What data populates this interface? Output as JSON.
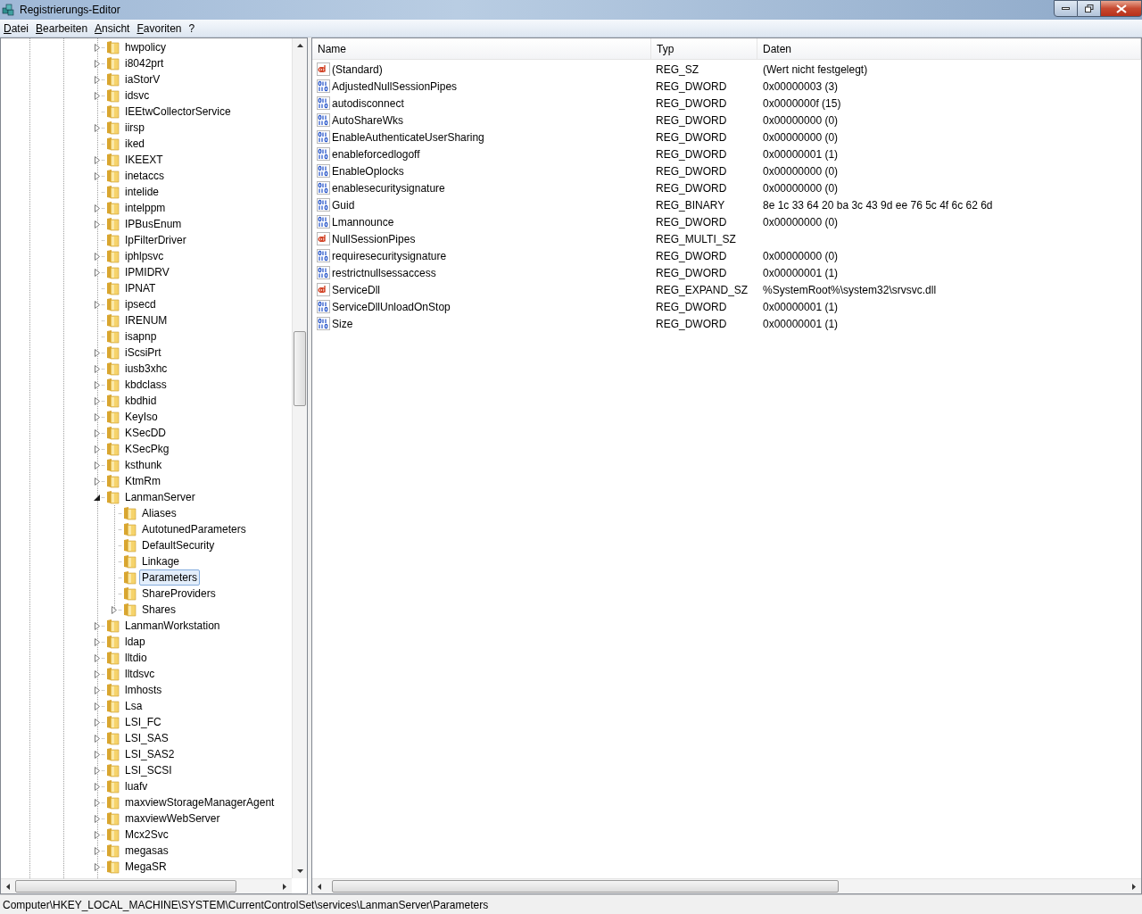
{
  "window": {
    "title": "Registrierungs-Editor"
  },
  "menu": [
    {
      "label": "Datei"
    },
    {
      "label": "Bearbeiten"
    },
    {
      "label": "Ansicht"
    },
    {
      "label": "Favoriten"
    },
    {
      "label": "?"
    }
  ],
  "tree": [
    {
      "label": "hwpolicy",
      "has_children": true,
      "expanded": false,
      "selected": false
    },
    {
      "label": "i8042prt",
      "has_children": true,
      "expanded": false,
      "selected": false
    },
    {
      "label": "iaStorV",
      "has_children": true,
      "expanded": false,
      "selected": false
    },
    {
      "label": "idsvc",
      "has_children": true,
      "expanded": false,
      "selected": false
    },
    {
      "label": "IEEtwCollectorService",
      "has_children": false,
      "selected": false
    },
    {
      "label": "iirsp",
      "has_children": true,
      "expanded": false,
      "selected": false
    },
    {
      "label": "iked",
      "has_children": false,
      "selected": false
    },
    {
      "label": "IKEEXT",
      "has_children": true,
      "expanded": false,
      "selected": false
    },
    {
      "label": "inetaccs",
      "has_children": true,
      "expanded": false,
      "selected": false
    },
    {
      "label": "intelide",
      "has_children": false,
      "selected": false
    },
    {
      "label": "intelppm",
      "has_children": true,
      "expanded": false,
      "selected": false
    },
    {
      "label": "IPBusEnum",
      "has_children": true,
      "expanded": false,
      "selected": false
    },
    {
      "label": "IpFilterDriver",
      "has_children": false,
      "selected": false
    },
    {
      "label": "iphlpsvc",
      "has_children": true,
      "expanded": false,
      "selected": false
    },
    {
      "label": "IPMIDRV",
      "has_children": true,
      "expanded": false,
      "selected": false
    },
    {
      "label": "IPNAT",
      "has_children": false,
      "selected": false
    },
    {
      "label": "ipsecd",
      "has_children": true,
      "expanded": false,
      "selected": false
    },
    {
      "label": "IRENUM",
      "has_children": false,
      "selected": false
    },
    {
      "label": "isapnp",
      "has_children": false,
      "selected": false
    },
    {
      "label": "iScsiPrt",
      "has_children": true,
      "expanded": false,
      "selected": false
    },
    {
      "label": "iusb3xhc",
      "has_children": true,
      "expanded": false,
      "selected": false
    },
    {
      "label": "kbdclass",
      "has_children": true,
      "expanded": false,
      "selected": false
    },
    {
      "label": "kbdhid",
      "has_children": true,
      "expanded": false,
      "selected": false
    },
    {
      "label": "KeyIso",
      "has_children": true,
      "expanded": false,
      "selected": false
    },
    {
      "label": "KSecDD",
      "has_children": true,
      "expanded": false,
      "selected": false
    },
    {
      "label": "KSecPkg",
      "has_children": true,
      "expanded": false,
      "selected": false
    },
    {
      "label": "ksthunk",
      "has_children": true,
      "expanded": false,
      "selected": false
    },
    {
      "label": "KtmRm",
      "has_children": true,
      "expanded": false,
      "selected": false
    },
    {
      "label": "LanmanServer",
      "has_children": true,
      "expanded": true,
      "selected": false,
      "children": [
        {
          "label": "Aliases",
          "has_children": false,
          "selected": false
        },
        {
          "label": "AutotunedParameters",
          "has_children": false,
          "selected": false
        },
        {
          "label": "DefaultSecurity",
          "has_children": false,
          "selected": false
        },
        {
          "label": "Linkage",
          "has_children": false,
          "selected": false
        },
        {
          "label": "Parameters",
          "has_children": false,
          "selected": true
        },
        {
          "label": "ShareProviders",
          "has_children": false,
          "selected": false
        },
        {
          "label": "Shares",
          "has_children": true,
          "expanded": false,
          "selected": false
        }
      ]
    },
    {
      "label": "LanmanWorkstation",
      "has_children": true,
      "expanded": false,
      "selected": false
    },
    {
      "label": "ldap",
      "has_children": true,
      "expanded": false,
      "selected": false
    },
    {
      "label": "lltdio",
      "has_children": true,
      "expanded": false,
      "selected": false
    },
    {
      "label": "lltdsvc",
      "has_children": true,
      "expanded": false,
      "selected": false
    },
    {
      "label": "lmhosts",
      "has_children": true,
      "expanded": false,
      "selected": false
    },
    {
      "label": "Lsa",
      "has_children": true,
      "expanded": false,
      "selected": false
    },
    {
      "label": "LSI_FC",
      "has_children": true,
      "expanded": false,
      "selected": false
    },
    {
      "label": "LSI_SAS",
      "has_children": true,
      "expanded": false,
      "selected": false
    },
    {
      "label": "LSI_SAS2",
      "has_children": true,
      "expanded": false,
      "selected": false
    },
    {
      "label": "LSI_SCSI",
      "has_children": true,
      "expanded": false,
      "selected": false
    },
    {
      "label": "luafv",
      "has_children": true,
      "expanded": false,
      "selected": false
    },
    {
      "label": "maxviewStorageManagerAgent",
      "has_children": true,
      "expanded": false,
      "selected": false
    },
    {
      "label": "maxviewWebServer",
      "has_children": true,
      "expanded": false,
      "selected": false
    },
    {
      "label": "Mcx2Svc",
      "has_children": true,
      "expanded": false,
      "selected": false
    },
    {
      "label": "megasas",
      "has_children": true,
      "expanded": false,
      "selected": false
    },
    {
      "label": "MegaSR",
      "has_children": true,
      "expanded": false,
      "selected": false
    }
  ],
  "table": {
    "columns": [
      "Name",
      "Typ",
      "Daten"
    ],
    "rows": [
      {
        "kind": "string",
        "name": "(Standard)",
        "type": "REG_SZ",
        "data": "(Wert nicht festgelegt)"
      },
      {
        "kind": "binary",
        "name": "AdjustedNullSessionPipes",
        "type": "REG_DWORD",
        "data": "0x00000003 (3)"
      },
      {
        "kind": "binary",
        "name": "autodisconnect",
        "type": "REG_DWORD",
        "data": "0x0000000f (15)"
      },
      {
        "kind": "binary",
        "name": "AutoShareWks",
        "type": "REG_DWORD",
        "data": "0x00000000 (0)"
      },
      {
        "kind": "binary",
        "name": "EnableAuthenticateUserSharing",
        "type": "REG_DWORD",
        "data": "0x00000000 (0)"
      },
      {
        "kind": "binary",
        "name": "enableforcedlogoff",
        "type": "REG_DWORD",
        "data": "0x00000001 (1)"
      },
      {
        "kind": "binary",
        "name": "EnableOplocks",
        "type": "REG_DWORD",
        "data": "0x00000000 (0)"
      },
      {
        "kind": "binary",
        "name": "enablesecuritysignature",
        "type": "REG_DWORD",
        "data": "0x00000000 (0)"
      },
      {
        "kind": "binary",
        "name": "Guid",
        "type": "REG_BINARY",
        "data": "8e 1c 33 64 20 ba 3c 43 9d ee 76 5c 4f 6c 62 6d"
      },
      {
        "kind": "binary",
        "name": "Lmannounce",
        "type": "REG_DWORD",
        "data": "0x00000000 (0)"
      },
      {
        "kind": "string",
        "name": "NullSessionPipes",
        "type": "REG_MULTI_SZ"
      },
      {
        "kind": "binary",
        "name": "requiresecuritysignature",
        "type": "REG_DWORD",
        "data": "0x00000000 (0)"
      },
      {
        "kind": "binary",
        "name": "restrictnullsessaccess",
        "type": "REG_DWORD",
        "data": "0x00000001 (1)"
      },
      {
        "kind": "string",
        "name": "ServiceDll",
        "type": "REG_EXPAND_SZ",
        "data": "%SystemRoot%\\system32\\srvsvc.dll"
      },
      {
        "kind": "binary",
        "name": "ServiceDllUnloadOnStop",
        "type": "REG_DWORD",
        "data": "0x00000001 (1)"
      },
      {
        "kind": "binary",
        "name": "Size",
        "type": "REG_DWORD",
        "data": "0x00000001 (1)"
      }
    ]
  },
  "status_bar": "Computer\\HKEY_LOCAL_MACHINE\\SYSTEM\\CurrentControlSet\\services\\LanmanServer\\Parameters"
}
